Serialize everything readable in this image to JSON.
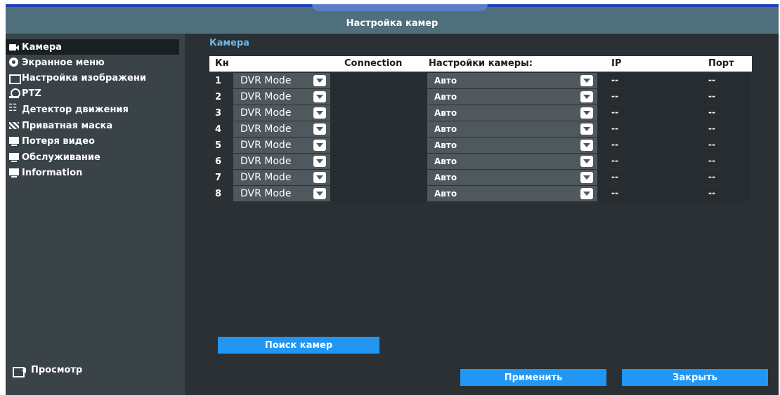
{
  "window": {
    "title": "Настройка камер"
  },
  "sidebar": {
    "items": [
      {
        "label": "Камера",
        "icon": "camera-icon"
      },
      {
        "label": "Экранное меню",
        "icon": "osd-icon"
      },
      {
        "label": "Настройка изображени",
        "icon": "image-settings-icon"
      },
      {
        "label": "PTZ",
        "icon": "ptz-icon"
      },
      {
        "label": "Детектор движения",
        "icon": "motion-detector-icon"
      },
      {
        "label": "Приватная маска",
        "icon": "privacy-mask-icon"
      },
      {
        "label": "Потеря видео",
        "icon": "monitor-icon"
      },
      {
        "label": "Обслуживание",
        "icon": "monitor-icon"
      },
      {
        "label": "Information",
        "icon": "monitor-icon"
      }
    ],
    "preview_label": "Просмотр"
  },
  "section": {
    "title": "Камера"
  },
  "table": {
    "headers": {
      "ch": "Кн",
      "connection": "Connection",
      "settings": "Настройки камеры:",
      "ip": "IP",
      "port": "Порт"
    },
    "rows": [
      {
        "ch": "1",
        "mode": "DVR Mode",
        "setting": "Авто",
        "ip": "--",
        "port": "--"
      },
      {
        "ch": "2",
        "mode": "DVR Mode",
        "setting": "Авто",
        "ip": "--",
        "port": "--"
      },
      {
        "ch": "3",
        "mode": "DVR Mode",
        "setting": "Авто",
        "ip": "--",
        "port": "--"
      },
      {
        "ch": "4",
        "mode": "DVR Mode",
        "setting": "Авто",
        "ip": "--",
        "port": "--"
      },
      {
        "ch": "5",
        "mode": "DVR Mode",
        "setting": "Авто",
        "ip": "--",
        "port": "--"
      },
      {
        "ch": "6",
        "mode": "DVR Mode",
        "setting": "Авто",
        "ip": "--",
        "port": "--"
      },
      {
        "ch": "7",
        "mode": "DVR Mode",
        "setting": "Авто",
        "ip": "--",
        "port": "--"
      },
      {
        "ch": "8",
        "mode": "DVR Mode",
        "setting": "Авто",
        "ip": "--",
        "port": "--"
      }
    ]
  },
  "buttons": {
    "search": "Поиск камер",
    "apply": "Применить",
    "close": "Закрыть"
  },
  "colors": {
    "accent": "#2196f3",
    "title_bar": "#4f6f7c",
    "section_title": "#6bb8e8"
  }
}
